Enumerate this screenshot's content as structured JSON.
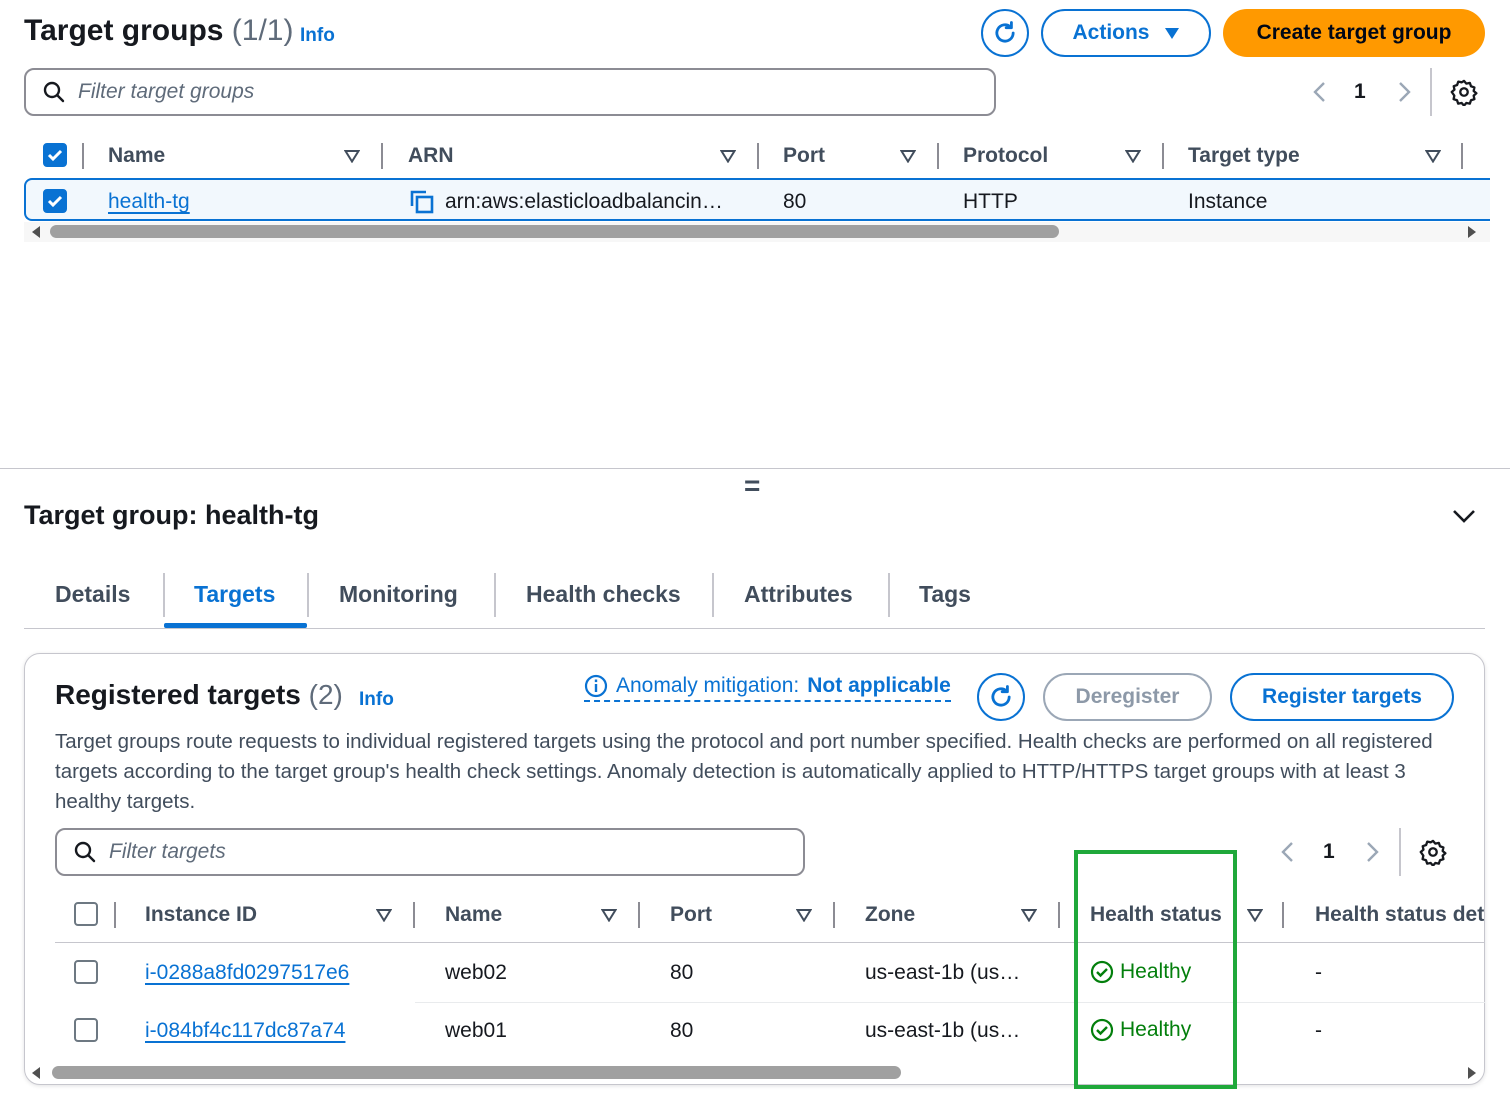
{
  "target_groups": {
    "title": "Target groups",
    "count": "(1/1)",
    "info": "Info",
    "actions_label": "Actions",
    "create_label": "Create target group",
    "filter_placeholder": "Filter target groups",
    "page": "1",
    "columns": [
      "Name",
      "ARN",
      "Port",
      "Protocol",
      "Target type"
    ],
    "rows": [
      {
        "name": "health-tg",
        "arn": "arn:aws:elasticloadbalancin…",
        "port": "80",
        "protocol": "HTTP",
        "target_type": "Instance"
      }
    ]
  },
  "detail": {
    "divider_handle": "=",
    "title": "Target group: health-tg",
    "tabs": [
      "Details",
      "Targets",
      "Monitoring",
      "Health checks",
      "Attributes",
      "Tags"
    ],
    "active_tab": "Targets"
  },
  "registered": {
    "title": "Registered targets",
    "count": "(2)",
    "info": "Info",
    "anomaly_label": "Anomaly mitigation:",
    "anomaly_value": "Not applicable",
    "deregister_label": "Deregister",
    "register_label": "Register targets",
    "description": "Target groups route requests to individual registered targets using the protocol and port number specified. Health checks are performed on all registered targets according to the target group's health check settings. Anomaly detection is automatically applied to HTTP/HTTPS target groups with at least 3 healthy targets.",
    "filter_placeholder": "Filter targets",
    "page": "1",
    "columns": [
      "Instance ID",
      "Name",
      "Port",
      "Zone",
      "Health status",
      "Health status det"
    ],
    "rows": [
      {
        "instance_id": "i-0288a8fd0297517e6",
        "name": "web02",
        "port": "80",
        "zone": "us-east-1b (us…",
        "health": "Healthy",
        "details": "-"
      },
      {
        "instance_id": "i-084bf4c117dc87a74",
        "name": "web01",
        "port": "80",
        "zone": "us-east-1b (us…",
        "health": "Healthy",
        "details": "-"
      }
    ]
  },
  "colors": {
    "link": "#0972d3",
    "primary_button": "#ff9900",
    "healthy": "#037f0c",
    "highlight_box": "#1fa83a"
  }
}
